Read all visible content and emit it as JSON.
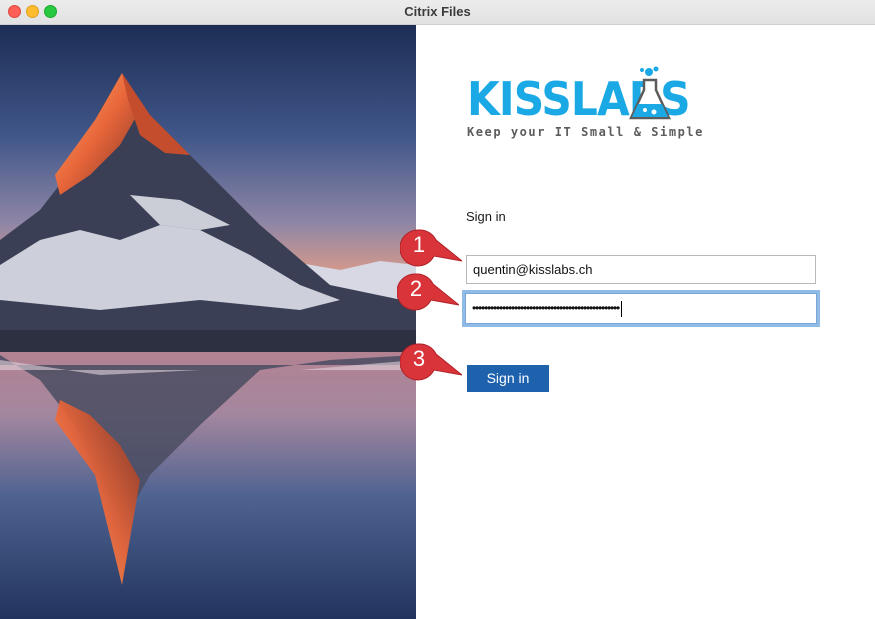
{
  "window": {
    "title": "Citrix Files"
  },
  "logo": {
    "wordmark": "KISSLABS",
    "tagline": "Keep your IT Small & Simple",
    "brand_color": "#1ba9e6"
  },
  "form": {
    "heading": "Sign in",
    "email_value": "quentin@kisslabs.ch",
    "password_masked": "•••••••••••••••••••••••••••••••••••••••••••••••••",
    "submit_label": "Sign in",
    "button_color": "#1e62ad"
  },
  "callouts": [
    "1",
    "2",
    "3"
  ],
  "callout_color": "#d9343a"
}
